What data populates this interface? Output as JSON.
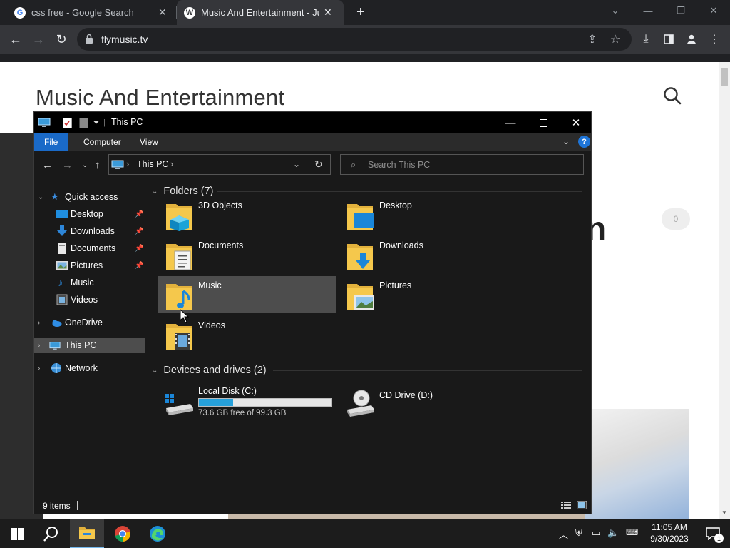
{
  "browser": {
    "tabs": [
      {
        "label": "css free - Google Search",
        "icon": "google-icon"
      },
      {
        "label": "Music And Entertainment - Just",
        "icon": "wordpress-icon"
      }
    ],
    "url": "flymusic.tv"
  },
  "website": {
    "title": "Music And Entertainment",
    "partial_heading": "n",
    "comment_count": "0"
  },
  "explorer": {
    "window_title": "This PC",
    "ribbon_tabs": [
      "File",
      "Computer",
      "View"
    ],
    "help": "?",
    "breadcrumb": [
      "This PC"
    ],
    "search_placeholder": "Search This PC",
    "nav": {
      "quick_access": "Quick access",
      "desktop": "Desktop",
      "downloads": "Downloads",
      "documents": "Documents",
      "pictures": "Pictures",
      "music": "Music",
      "videos": "Videos",
      "onedrive": "OneDrive",
      "this_pc": "This PC",
      "network": "Network"
    },
    "folders_header": "Folders (7)",
    "folders": {
      "objects3d": "3D Objects",
      "desktop": "Desktop",
      "documents": "Documents",
      "downloads": "Downloads",
      "music": "Music",
      "pictures": "Pictures",
      "videos": "Videos"
    },
    "drives_header": "Devices and drives (2)",
    "drives": {
      "c_name": "Local Disk (C:)",
      "c_free": "73.6 GB free of 99.3 GB",
      "c_used_fraction": 0.259,
      "d_name": "CD Drive (D:)"
    },
    "status": "9 items"
  },
  "taskbar": {
    "time": "11:05 AM",
    "date": "9/30/2023",
    "notifications": "1"
  },
  "colors": {
    "explorer_bg": "#191919",
    "accent": "#1a6ac8",
    "drive_bar": "#26a0da",
    "folder_yellow": "#f5c84c"
  }
}
